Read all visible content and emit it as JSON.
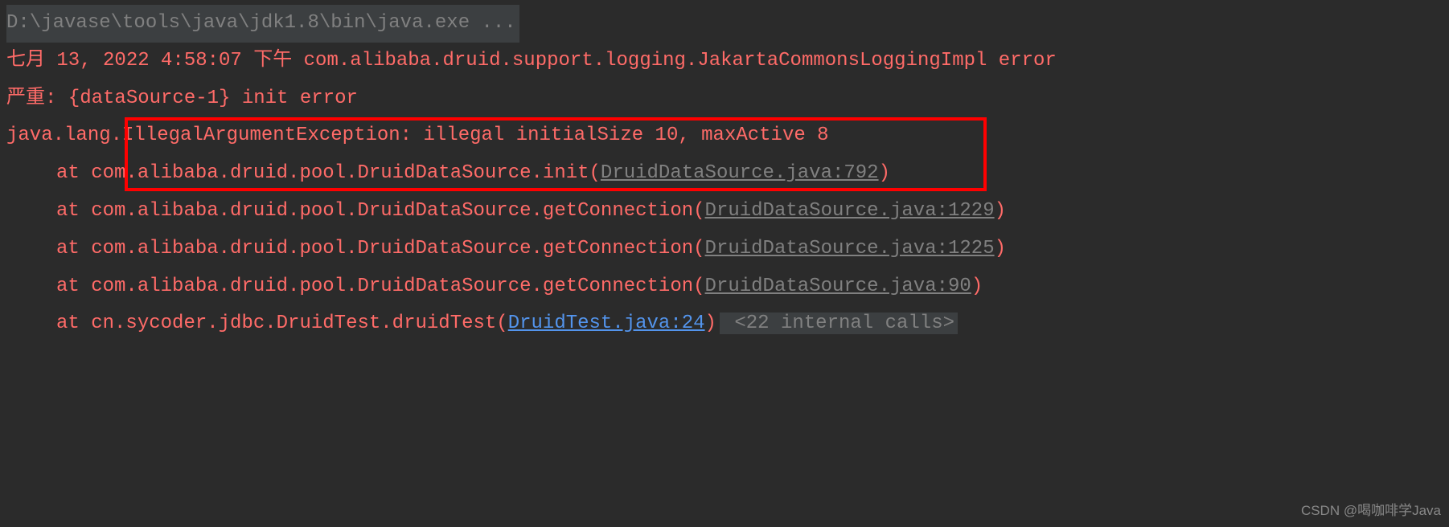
{
  "cmd": "D:\\javase\\tools\\java\\jdk1.8\\bin\\java.exe ...",
  "log_ts_prefix": "七月 13, 2022 4:58:07 下午 ",
  "log_ts_rest": "com.alibaba.druid.support.logging.JakartaCommonsLoggingImpl error",
  "severe_prefix": "严重: ",
  "severe_rest": "{dataSource-1} init error",
  "exc_pkg": "java.lang",
  "exc_msg": ".IllegalArgumentException: illegal initialSize 10, maxActive 8",
  "trace": [
    {
      "at": "at ",
      "method": "com.alibaba.druid.pool.DruidDataSource.init(",
      "link": "DruidDataSource.java:792",
      "linkType": "gray",
      "close": ")"
    },
    {
      "at": "at ",
      "method": "com.alibaba.druid.pool.DruidDataSource.getConnection(",
      "link": "DruidDataSource.java:1229",
      "linkType": "gray",
      "close": ")"
    },
    {
      "at": "at ",
      "method": "com.alibaba.druid.pool.DruidDataSource.getConnection(",
      "link": "DruidDataSource.java:1225",
      "linkType": "gray",
      "close": ")"
    },
    {
      "at": "at ",
      "method": "com.alibaba.druid.pool.DruidDataSource.getConnection(",
      "link": "DruidDataSource.java:90",
      "linkType": "gray",
      "close": ")"
    },
    {
      "at": "at ",
      "method": "cn.sycoder.jdbc.DruidTest.druidTest(",
      "link": "DruidTest.java:24",
      "linkType": "blue",
      "close": ")",
      "internal": " <22 internal calls>"
    }
  ],
  "watermark": "CSDN @喝咖啡学Java"
}
